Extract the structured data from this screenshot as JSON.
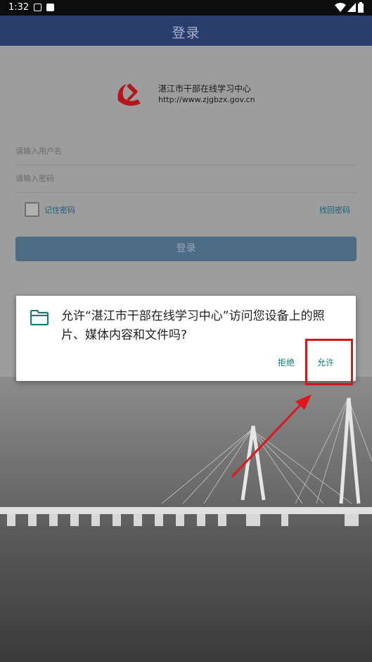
{
  "status_bar": {
    "time": "1:32"
  },
  "app_bar": {
    "title": "登录"
  },
  "header": {
    "site_name": "湛江市干部在线学习中心",
    "site_url": "http://www.zjgbzx.gov.cn"
  },
  "form": {
    "username_placeholder": "请输入用户名",
    "password_placeholder": "请输入密码",
    "remember_label": "记住密码",
    "forgot_label": "找回密码",
    "login_button": "登录"
  },
  "dialog": {
    "message": "允许“湛江市干部在线学习中心”访问您设备上的照片、媒体内容和文件吗?",
    "deny": "拒绝",
    "allow": "允许",
    "icon": "folder-icon"
  },
  "colors": {
    "app_bar": "#2a3e6b",
    "accent": "#0f7c75",
    "highlight": "#d5161b"
  }
}
